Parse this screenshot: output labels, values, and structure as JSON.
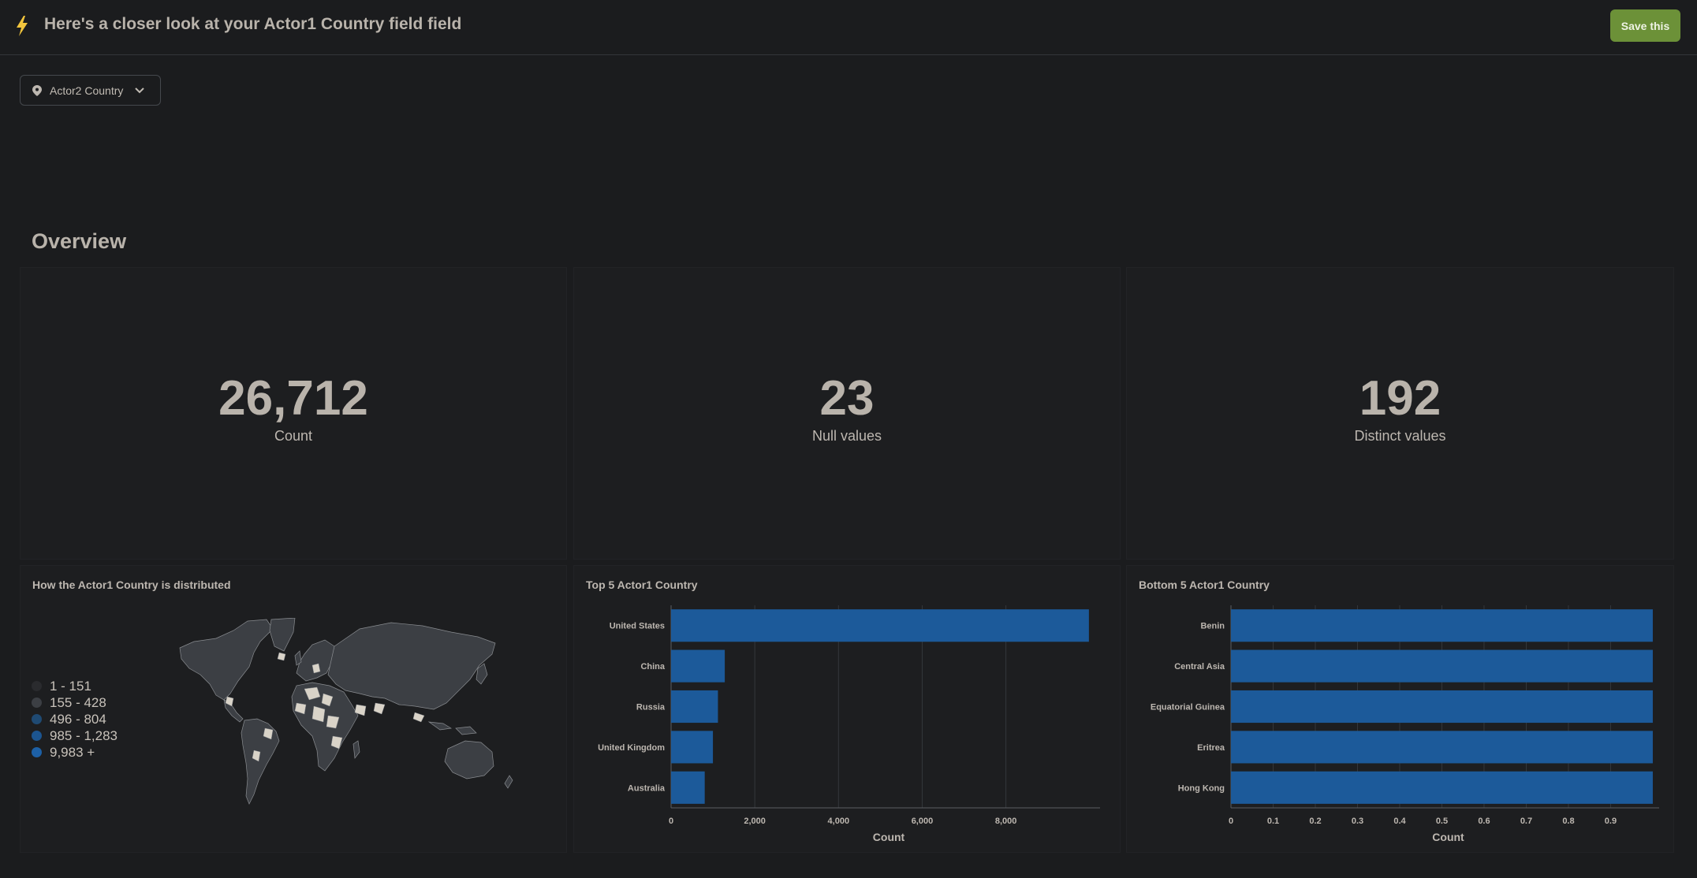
{
  "header": {
    "title": "Here's a closer look at your Actor1 Country field field",
    "save_label": "Save this"
  },
  "field_selector": {
    "value": "Actor2 Country"
  },
  "overview": {
    "title": "Overview",
    "metrics": [
      {
        "value": "26,712",
        "label": "Count"
      },
      {
        "value": "23",
        "label": "Null values"
      },
      {
        "value": "192",
        "label": "Distinct values"
      }
    ]
  },
  "map_card": {
    "title": "How the Actor1 Country is distributed",
    "legend": [
      {
        "label": "1 - 151",
        "color": "#2a2b2e"
      },
      {
        "label": "155 - 428",
        "color": "#3c3f44"
      },
      {
        "label": "496 - 804",
        "color": "#1f4a73"
      },
      {
        "label": "985 - 1,283",
        "color": "#1c5590"
      },
      {
        "label": "9,983 +",
        "color": "#1d60a6"
      }
    ]
  },
  "chart_data": [
    {
      "type": "bar",
      "orientation": "horizontal",
      "title": "Top 5 Actor1 Country",
      "categories": [
        "United States",
        "China",
        "Russia",
        "United Kingdom",
        "Australia"
      ],
      "values": [
        9983,
        1283,
        1120,
        1000,
        804
      ],
      "xlabel": "Count",
      "xlim": [
        0,
        10400
      ],
      "xticks": [
        0,
        2000,
        4000,
        6000,
        8000
      ],
      "xtick_labels": [
        "0",
        "2,000",
        "4,000",
        "6,000",
        "8,000"
      ],
      "grid": true,
      "color": "#1c5a9a"
    },
    {
      "type": "bar",
      "orientation": "horizontal",
      "title": "Bottom 5 Actor1 Country",
      "categories": [
        "Benin",
        "Central Asia",
        "Equatorial Guinea",
        "Eritrea",
        "Hong Kong"
      ],
      "values": [
        1,
        1,
        1,
        1,
        1
      ],
      "xlabel": "Count",
      "xlim": [
        0,
        1.03
      ],
      "xticks": [
        0,
        0.1,
        0.2,
        0.3,
        0.4,
        0.5,
        0.6,
        0.7,
        0.8,
        0.9
      ],
      "xtick_labels": [
        "0",
        "0.1",
        "0.2",
        "0.3",
        "0.4",
        "0.5",
        "0.6",
        "0.7",
        "0.8",
        "0.9"
      ],
      "grid": true,
      "color": "#1c5a9a"
    }
  ],
  "colors": {
    "background": "#1b1c1e",
    "accent": "#6c9138",
    "bar": "#1c5a9a",
    "bolt": "#f2c53d"
  }
}
